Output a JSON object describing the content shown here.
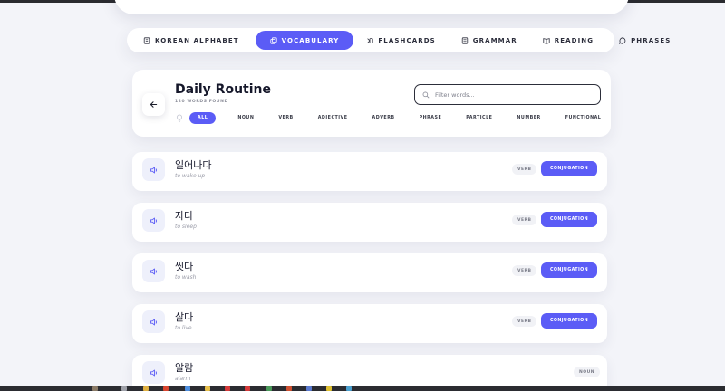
{
  "nav": {
    "items": [
      {
        "label": "KOREAN ALPHABET",
        "icon": "book-icon",
        "active": false
      },
      {
        "label": "VOCABULARY",
        "icon": "cards-icon",
        "active": true
      },
      {
        "label": "FLASHCARDS",
        "icon": "flashcard-icon",
        "active": false
      },
      {
        "label": "GRAMMAR",
        "icon": "grammar-icon",
        "active": false
      },
      {
        "label": "READING",
        "icon": "open-book-icon",
        "active": false
      },
      {
        "label": "PHRASES",
        "icon": "chat-icon",
        "active": false
      }
    ]
  },
  "header": {
    "title": "Daily Routine",
    "subtitle": "120 WORDS FOUND",
    "search_placeholder": "Filter words..."
  },
  "filters": [
    "ALL",
    "NOUN",
    "VERB",
    "ADJECTIVE",
    "ADVERB",
    "PHRASE",
    "PARTICLE",
    "NUMBER",
    "FUNCTIONAL"
  ],
  "words": [
    {
      "korean": "일어나다",
      "english": "to wake up",
      "pos": "VERB",
      "action": "CONJUGATION"
    },
    {
      "korean": "자다",
      "english": "to sleep",
      "pos": "VERB",
      "action": "CONJUGATION"
    },
    {
      "korean": "씻다",
      "english": "to wash",
      "pos": "VERB",
      "action": "CONJUGATION"
    },
    {
      "korean": "살다",
      "english": "to live",
      "pos": "VERB",
      "action": "CONJUGATION"
    },
    {
      "korean": "알람",
      "english": "alarm",
      "pos": "NOUN",
      "action": ""
    }
  ],
  "colors": {
    "accent": "#5b5cf6",
    "background": "#f3f4f9",
    "card": "#ffffff"
  }
}
